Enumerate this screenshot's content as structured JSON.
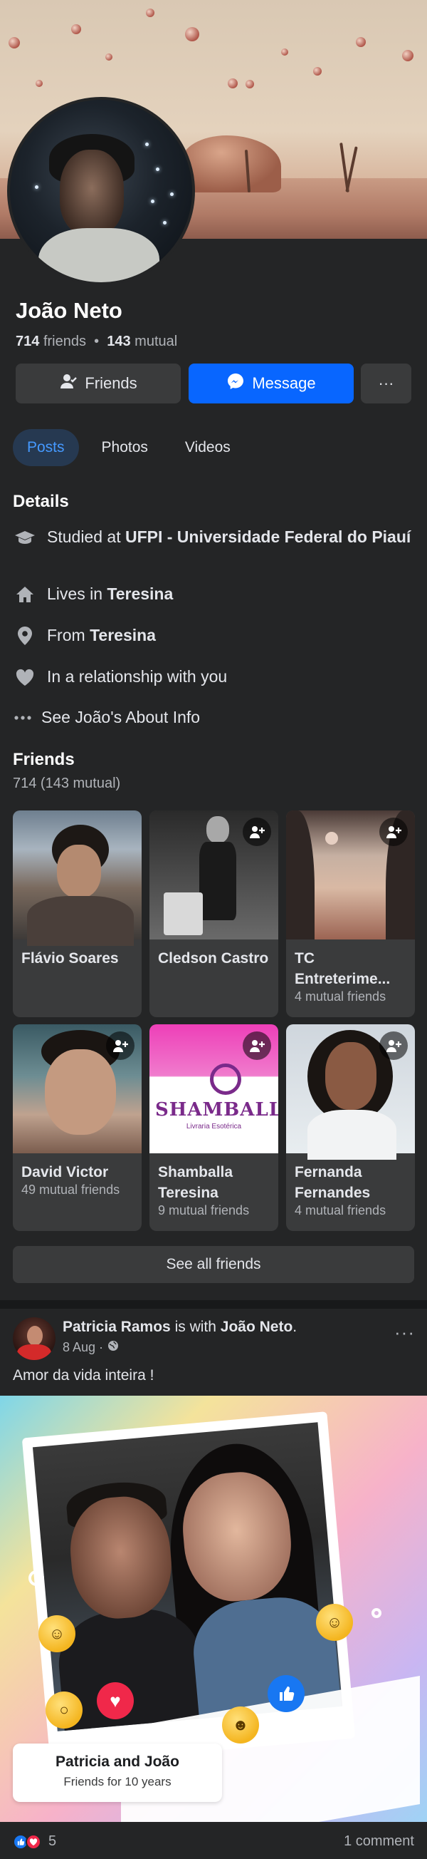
{
  "profile": {
    "name": "João Neto",
    "friends_count": "714",
    "friends_word": "friends",
    "mutual_count": "143",
    "mutual_word": "mutual"
  },
  "actions": {
    "friends_label": "Friends",
    "message_label": "Message",
    "more_label": "···"
  },
  "tabs": [
    {
      "label": "Posts",
      "active": true
    },
    {
      "label": "Photos",
      "active": false
    },
    {
      "label": "Videos",
      "active": false
    }
  ],
  "details": {
    "title": "Details",
    "education_prefix": "Studied at ",
    "education_value": "UFPI - Universidade Federal do Piauí",
    "lives_prefix": "Lives in ",
    "lives_value": "Teresina",
    "from_prefix": "From ",
    "from_value": "Teresina",
    "relationship": "In a relationship with you",
    "about_link": "See João's About Info"
  },
  "friends": {
    "title": "Friends",
    "subtitle": "714 (143 mutual)",
    "see_all": "See all friends",
    "cards": [
      {
        "name": "Flávio Soares",
        "mutual": ""
      },
      {
        "name": "Cledson Castro",
        "mutual": ""
      },
      {
        "name": "TC Entreterime...",
        "mutual": "4 mutual friends"
      },
      {
        "name": "David Victor",
        "mutual": "49 mutual friends"
      },
      {
        "name": "Shamballa Teresina",
        "mutual": "9 mutual friends"
      },
      {
        "name": "Fernanda Fernandes",
        "mutual": "4 mutual friends"
      }
    ],
    "shamballa_logo_text": "SHAMBALLA",
    "shamballa_logo_sub": "Livraria Esotérica"
  },
  "post": {
    "author": "Patricia Ramos",
    "with_word": " is with ",
    "tagged": "João Neto",
    "date": "8 Aug ·",
    "more": "···",
    "text": "Amor da vida inteira !",
    "card_title": "Patricia and João",
    "card_subtitle": "Friends for 10 years",
    "reaction_count": "5",
    "comments": "1 comment"
  },
  "colors": {
    "background": "#242526",
    "button": "#3a3b3c",
    "primary": "#0866ff",
    "active_tab_bg": "#263951",
    "active_tab_text": "#4599ff"
  }
}
